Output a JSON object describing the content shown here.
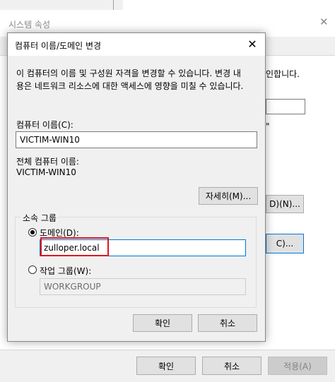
{
  "background_window": {
    "title": "시스템 속성",
    "partial_text_1": "인합니다.",
    "partial_text_2": "\"",
    "button_d_label": "D)(N)...",
    "button_c_label": "C)...",
    "ok_label": "확인",
    "cancel_label": "취소",
    "apply_label": "적용(A)"
  },
  "dialog": {
    "title": "컴퓨터 이름/도메인 변경",
    "description": "이 컴퓨터의 이름 및 구성원 자격을 변경할 수 있습니다. 변경 내용은 네트워크 리소스에 대한 액세스에 영향을 미칠 수 있습니다.",
    "description_line1": "이 컴퓨터의 이름 및 구성원 자격을 변경할 수 있습니다. 변경 내",
    "description_line2": "용은 네트워크 리소스에 대한 액세스에 영향을 미칠 수 있습니다.",
    "computer_name_label": "컴퓨터 이름(C):",
    "computer_name_value": "VICTIM-WIN10",
    "full_name_label": "전체 컴퓨터 이름:",
    "full_name_value": "VICTIM-WIN10",
    "more_button": "자세히(M)...",
    "member_of_label": "소속 그룹",
    "domain_label": "도메인(D):",
    "domain_value": "zulloper.local",
    "domain_selected": true,
    "workgroup_label": "작업 그룹(W):",
    "workgroup_value": "WORKGROUP",
    "ok_label": "확인",
    "cancel_label": "취소",
    "close_glyph": "✕"
  },
  "colors": {
    "highlight_box": "#e0141e",
    "focus_border": "#0078d7"
  }
}
